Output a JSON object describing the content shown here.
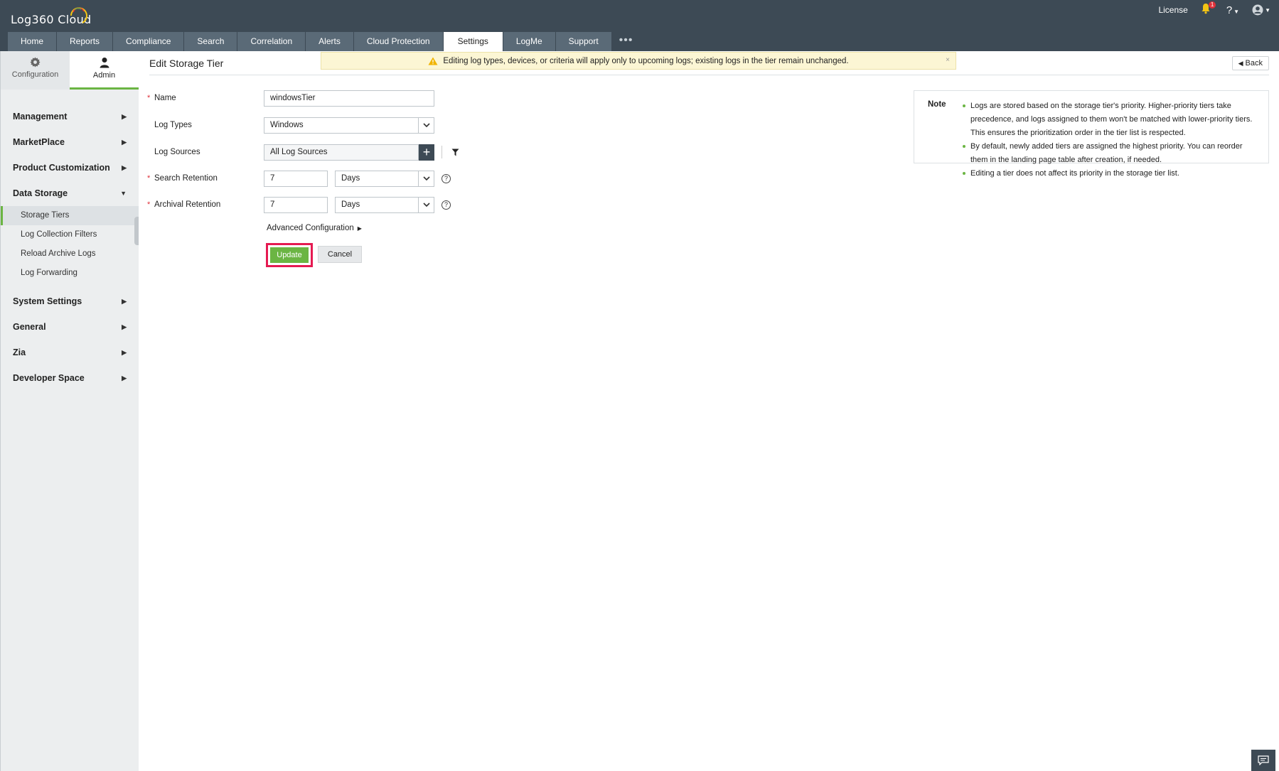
{
  "app": {
    "logo_text": "Log360  Cloud",
    "license_label": "License",
    "notification_count": "1",
    "help_label": "?"
  },
  "tabs": [
    {
      "label": "Home"
    },
    {
      "label": "Reports"
    },
    {
      "label": "Compliance"
    },
    {
      "label": "Search"
    },
    {
      "label": "Correlation"
    },
    {
      "label": "Alerts"
    },
    {
      "label": "Cloud Protection"
    },
    {
      "label": "Settings"
    },
    {
      "label": "LogMe"
    },
    {
      "label": "Support"
    }
  ],
  "tabs_more": "•••",
  "sidebar": {
    "tabs": [
      {
        "label": "Configuration",
        "icon": "gear-icon"
      },
      {
        "label": "Admin",
        "icon": "admin-user-icon"
      }
    ],
    "menu": [
      {
        "label": "Management"
      },
      {
        "label": "MarketPlace"
      },
      {
        "label": "Product Customization"
      },
      {
        "label": "Data Storage"
      },
      {
        "label": "System Settings"
      },
      {
        "label": "General"
      },
      {
        "label": "Zia"
      },
      {
        "label": "Developer Space"
      }
    ],
    "data_storage_items": [
      {
        "label": "Storage Tiers"
      },
      {
        "label": "Log Collection Filters"
      },
      {
        "label": "Reload Archive Logs"
      },
      {
        "label": "Log Forwarding"
      }
    ]
  },
  "main": {
    "title": "Edit Storage Tier",
    "alert_text": "Editing log types, devices, or criteria will apply only to upcoming logs; existing logs in the tier remain unchanged.",
    "alert_close": "×",
    "back_label": "Back",
    "form": {
      "name_label": "Name",
      "name_value": "windowsTier",
      "log_types_label": "Log Types",
      "log_types_value": "Windows",
      "log_sources_label": "Log Sources",
      "log_sources_value": "All Log Sources",
      "search_retention_label": "Search Retention",
      "search_retention_value": "7",
      "search_retention_unit": "Days",
      "archival_retention_label": "Archival Retention",
      "archival_retention_value": "7",
      "archival_retention_unit": "Days",
      "required_mark": "*",
      "help_mark": "?"
    },
    "advanced_label": "Advanced Configuration",
    "update_label": "Update",
    "cancel_label": "Cancel",
    "note": {
      "title": "Note",
      "items": [
        "Logs are stored based on the storage tier's priority. Higher-priority tiers take precedence, and logs assigned to them won't be matched with lower-priority tiers. This ensures the prioritization order in the tier list is respected.",
        "By default, newly added tiers are assigned the highest priority. You can reorder them in the landing page table after creation, if needed.",
        "Editing a tier does not affect its priority in the storage tier list."
      ]
    }
  },
  "colors": {
    "header_bg": "#3d4a55",
    "tab_bg": "#5a6a77",
    "accent_green": "#6bb543",
    "highlight_pink": "#e51a51",
    "alert_bg": "#fcf6d4"
  }
}
